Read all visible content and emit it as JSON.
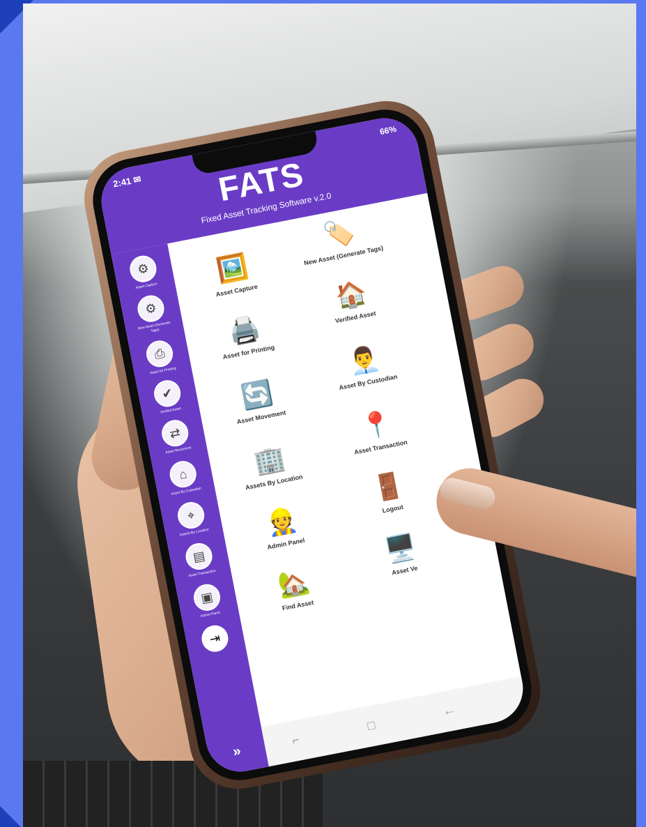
{
  "status": {
    "time": "2:41 ✉",
    "battery": "66%"
  },
  "app": {
    "title": "FATS",
    "subtitle": "Fixed Asset Tracking Software v.2.0"
  },
  "sidebar": {
    "items": [
      {
        "label": "Asset Capture",
        "icon": "gear-icon"
      },
      {
        "label": "New Asset (Generate Tags)",
        "icon": "tag-icon"
      },
      {
        "label": "Asset for Printing",
        "icon": "printer-icon"
      },
      {
        "label": "Verified Asset",
        "icon": "check-document-icon"
      },
      {
        "label": "Asset Movement",
        "icon": "movement-icon"
      },
      {
        "label": "Asset By Custodian",
        "icon": "custodian-icon"
      },
      {
        "label": "Assets By Location",
        "icon": "location-icon"
      },
      {
        "label": "Asset Transaction",
        "icon": "transaction-icon"
      },
      {
        "label": "Admin Panel",
        "icon": "admin-icon"
      },
      {
        "label": "",
        "icon": "logout-icon"
      }
    ],
    "more": "»"
  },
  "tiles": [
    {
      "label": "Asset Capture",
      "icon": "capture-icon",
      "glyph": "🖼️"
    },
    {
      "label": "New Asset (Generate Tags)",
      "icon": "tag-icon",
      "glyph": "🏷️"
    },
    {
      "label": "Asset for Printing",
      "icon": "printer-icon",
      "glyph": "🖨️"
    },
    {
      "label": "Verified Asset",
      "icon": "house-search-icon",
      "glyph": "🏠"
    },
    {
      "label": "Asset Movement",
      "icon": "movement-icon",
      "glyph": "🔄"
    },
    {
      "label": "Asset By Custodian",
      "icon": "custodian-icon",
      "glyph": "👨‍💼"
    },
    {
      "label": "Assets By Location",
      "icon": "location-icon",
      "glyph": "🏢"
    },
    {
      "label": "Asset Transaction",
      "icon": "transaction-icon",
      "glyph": "📍"
    },
    {
      "label": "Admin Panel",
      "icon": "admin-icon",
      "glyph": "👷"
    },
    {
      "label": "Logout",
      "icon": "logout-icon",
      "glyph": "🚪"
    },
    {
      "label": "Find Asset",
      "icon": "house-search-icon",
      "glyph": "🏡"
    },
    {
      "label": "Asset Ve",
      "icon": "verify-icon",
      "glyph": "🖥️"
    }
  ],
  "navbar": {
    "recent": "⌐",
    "home": "□",
    "back": "←"
  },
  "colors": {
    "frame": "#5a78f0",
    "header": "#6a3cc6"
  }
}
